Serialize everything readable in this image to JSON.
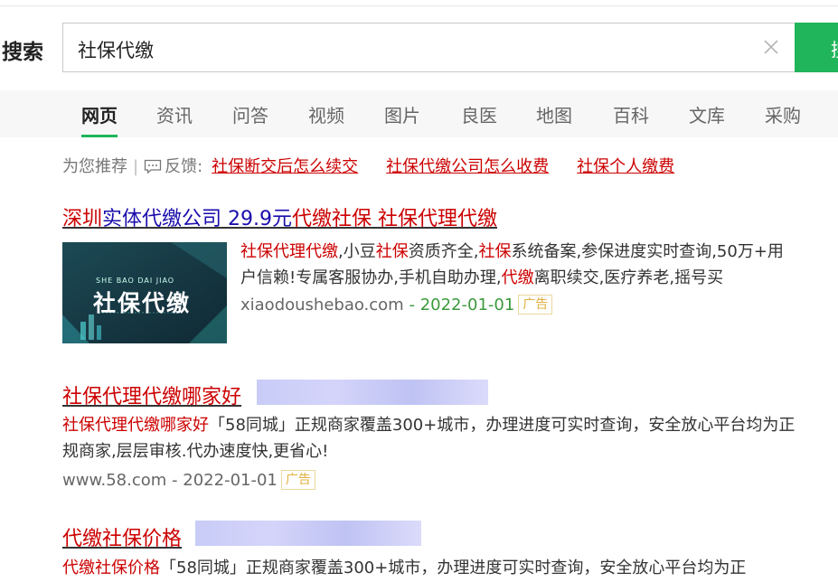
{
  "search": {
    "label": "搜索",
    "query": "社保代缴",
    "button_label": "搜"
  },
  "tabs": [
    "网页",
    "资讯",
    "问答",
    "视频",
    "图片",
    "良医",
    "地图",
    "百科",
    "文库",
    "采购"
  ],
  "recommend": {
    "label": "为您推荐",
    "feedback_label": "反馈:",
    "links": [
      "社保断交后怎么续交",
      "社保代缴公司怎么收费",
      "社保个人缴费"
    ]
  },
  "results": [
    {
      "title_parts": [
        "深圳",
        "实体代缴公司 29.9元",
        "代缴社保 社保代理代缴"
      ],
      "desc_parts": [
        "社保代理代缴",
        ",小豆",
        "社保",
        "资质齐全,",
        "社保",
        "系统备案,参保进度实时查询,50万+用户信赖!专属客服协办,手机自助办理,",
        "代缴",
        "离职续交,医疗养老,摇号买"
      ],
      "domain": "xiaodoushebao.com",
      "date": "2022-01-01",
      "ad_label": "广告",
      "image": {
        "top_text": "SHE BAO DAI JIAO",
        "main_text": "社保代缴"
      }
    },
    {
      "title": "社保代理代缴哪家好",
      "desc_highlight": "社保代理代缴哪家好",
      "desc_rest": "「58同城」正规商家覆盖300+城市，办理进度可实时查询，安全放心平台均为正规商家,层层审核.代办速度快,更省心!",
      "domain": "www.58.com",
      "date": "2022-01-01",
      "ad_label": "广告"
    },
    {
      "title": "代缴社保价格",
      "desc_highlight": "代缴社保价格",
      "desc_rest": "「58同城」正规商家覆盖300+城市，办理进度可实时查询，安全放心平台均为正"
    }
  ],
  "colors": {
    "accent_green": "#20b55a",
    "link_red": "#cc0000",
    "link_blue": "#1a0dab"
  }
}
